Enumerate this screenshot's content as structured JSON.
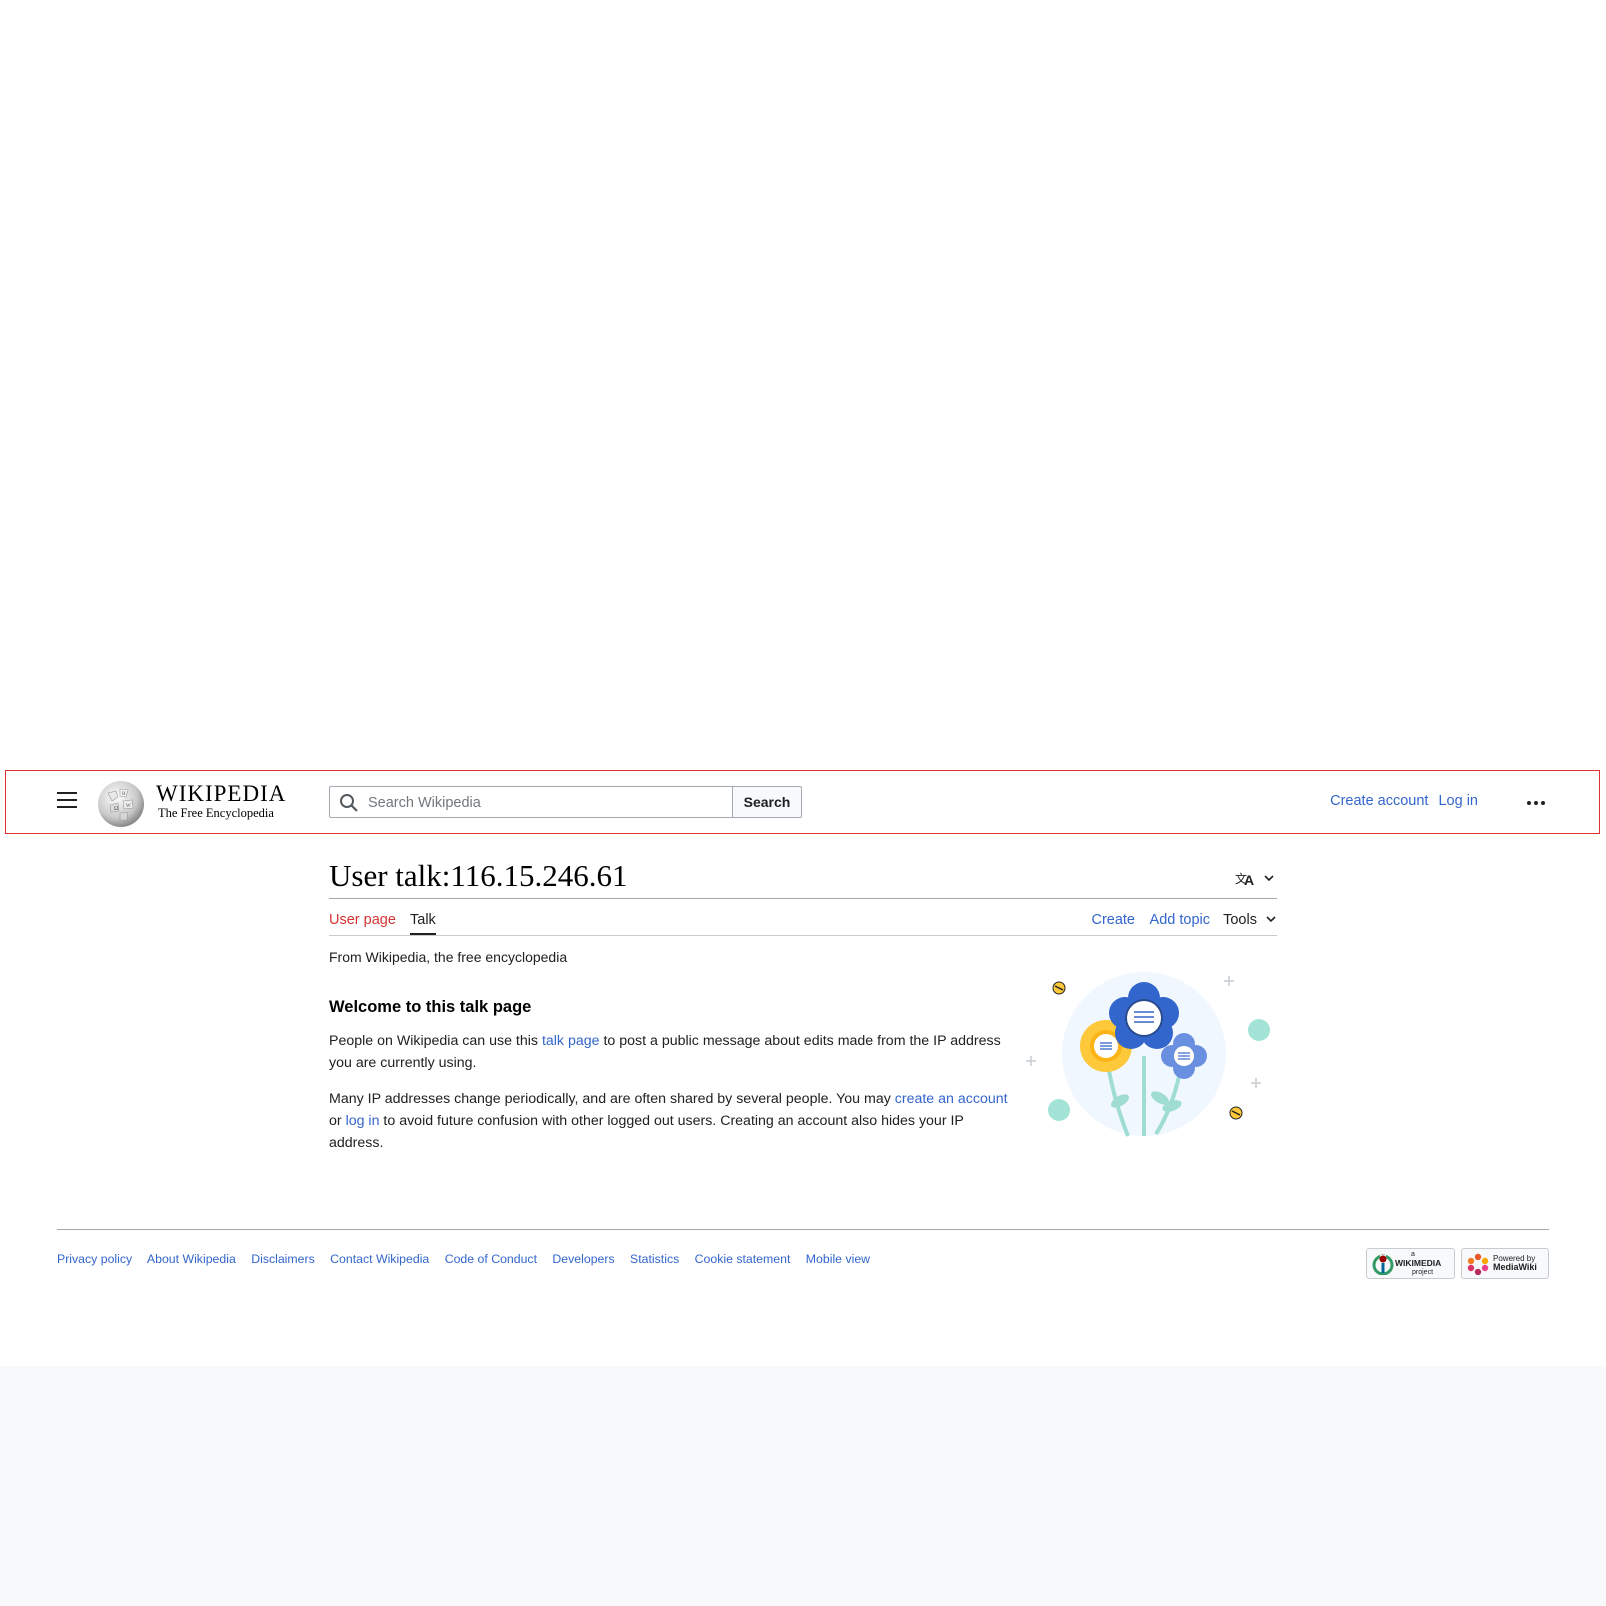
{
  "header": {
    "wordmark_title": "WIKIPEDIA",
    "wordmark_tagline": "The Free Encyclopedia",
    "search_placeholder": "Search Wikipedia",
    "search_button": "Search",
    "create_account": "Create account",
    "log_in": "Log in"
  },
  "page": {
    "title": "User talk:116.15.246.61",
    "tabs": {
      "user_page": "User page",
      "talk": "Talk",
      "create": "Create",
      "add_topic": "Add topic",
      "tools": "Tools"
    },
    "tagline": "From Wikipedia, the free encyclopedia",
    "welcome_heading": "Welcome to this talk page",
    "para1": {
      "before": "People on Wikipedia can use this ",
      "link": "talk page",
      "after": " to post a public message about edits made from the IP address you are currently using."
    },
    "para2": {
      "before": "Many IP addresses change periodically, and are often shared by several people. You may ",
      "link1": "create an account",
      "middle": " or ",
      "link2": "log in",
      "after": " to avoid future confusion with other logged out users. Creating an account also hides your IP address."
    }
  },
  "footer": {
    "links": [
      "Privacy policy",
      "About Wikipedia",
      "Disclaimers",
      "Contact Wikipedia",
      "Code of Conduct",
      "Developers",
      "Statistics",
      "Cookie statement",
      "Mobile view"
    ],
    "wikimedia_badge": "WIKIMEDIA",
    "wikimedia_badge_sub": "project",
    "wikimedia_badge_top": "a",
    "mediawiki_badge_line1": "Powered by",
    "mediawiki_badge_line2": "MediaWiki"
  },
  "colors": {
    "link": "#3366cc",
    "redlink": "#d73333",
    "highlight_border": "#dd3333"
  }
}
